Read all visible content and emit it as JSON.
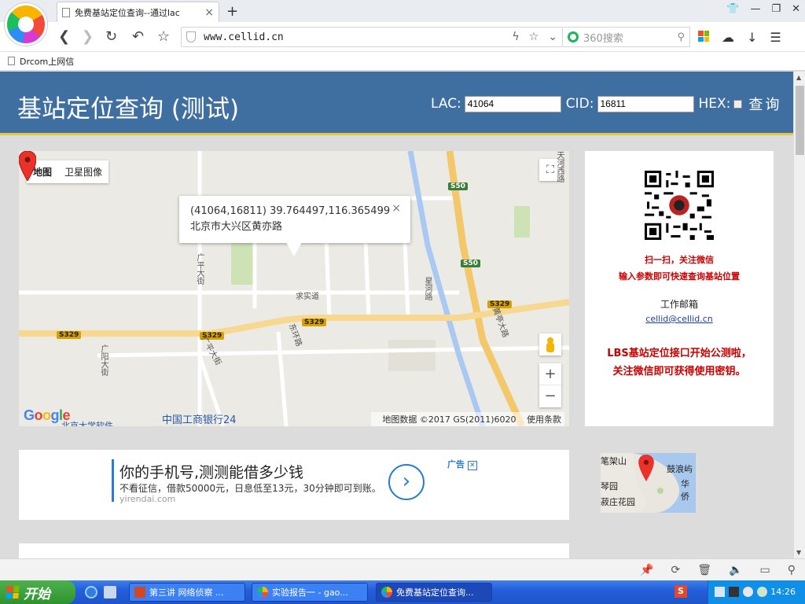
{
  "browser": {
    "tab_title": "免费基站定位查询--通过lac",
    "tab_close": "×",
    "new_tab": "+",
    "url": "www.cellid.cn",
    "search_placeholder": "360搜索",
    "bookmark": "Drcom上网信"
  },
  "header": {
    "title": "基站定位查询 (测试)",
    "lac_label": "LAC:",
    "lac_value": "41064",
    "cid_label": "CID:",
    "cid_value": "16811",
    "hex_label": "HEX:",
    "query_button": "查询"
  },
  "map": {
    "type_map": "地图",
    "type_satellite": "卫星图像",
    "info_line1": "(41064,16811) 39.764497,116.365499",
    "info_line2": "北京市大兴区黄亦路",
    "info_close": "×",
    "zoom_in": "+",
    "zoom_out": "−",
    "attribution": "地图数据 ©2017 GS(2011)6020",
    "terms": "使用条款",
    "labels": {
      "guangping_n": "广平大街",
      "guangping_s": "广平大街",
      "guangyang": "广阳大街",
      "huangting": "黄亭大路",
      "dongcheng": "东环路",
      "qiushi": "求实道",
      "bank": "中国工商银行24",
      "univ": "北京大学软件",
      "xinghuan": "星河路",
      "tianhe": "天河西路"
    },
    "shields": {
      "s50a": "S50",
      "s50b": "S50",
      "s329a": "S329",
      "s329b": "S329",
      "s329c": "S329"
    }
  },
  "side": {
    "scan_line1": "扫一扫，关注微信",
    "scan_line2": "输入参数即可快速查询基站位置",
    "mail_label": "工作邮箱",
    "mail": "cellid@cellid.cn",
    "lbs_line1": "LBS基站定位接口开始公测啦，",
    "lbs_line2": "关注微信即可获得使用密钥。"
  },
  "ad": {
    "title": "你的手机号,测测能借多少钱",
    "desc": "不看征信，借款50000元，日息低至13元，30分钟即可到账。",
    "url": "yirendai.com",
    "badge": "广告",
    "badge_close": "✕"
  },
  "mini_map": {
    "l1": "笔架山",
    "l2": "鼓浪屿",
    "l3": "琴园",
    "l4": "华侨",
    "l5": "菽庄花园"
  },
  "taskbar": {
    "start": "开始",
    "tasks": [
      "第三讲 网络侦察 ...",
      "实验报告一 - gao...",
      "免费基站定位查询..."
    ],
    "ime": "S",
    "clock": "14:26"
  },
  "colors": {
    "header_bg": "#3f6fa0",
    "accent_red": "#cc0000",
    "header_underline": "#e8c547"
  }
}
